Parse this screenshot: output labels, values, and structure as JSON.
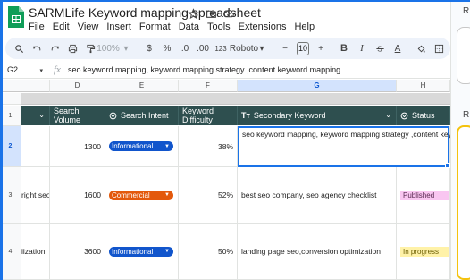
{
  "app": {
    "title": "SARMLife Keyword mapping spreadsheet",
    "menu": [
      "File",
      "Edit",
      "View",
      "Insert",
      "Format",
      "Data",
      "Tools",
      "Extensions",
      "Help"
    ]
  },
  "toolbar": {
    "zoom": "100%",
    "currency": "$",
    "percent": "%",
    "decrease_decimal": ".0",
    "increase_decimal": ".00",
    "number_format": "123",
    "font": "Roboto",
    "font_size": "10",
    "bold": "B",
    "italic": "I",
    "text_color": "A"
  },
  "formula_bar": {
    "cell_ref": "G2",
    "fx": "fx",
    "content": "seo keyword mapping, keyword mapping strategy ,content keyword mapping"
  },
  "columns": [
    "D",
    "E",
    "F",
    "G",
    "H"
  ],
  "rows": [
    "1",
    "2",
    "3",
    "4"
  ],
  "table": {
    "headers": {
      "search_volume": "Search Volume",
      "search_intent": "Search Intent",
      "keyword_difficulty": "Keyword Difficulty",
      "secondary_keyword": "Secondary Keyword",
      "status": "Status"
    },
    "rows": [
      {
        "partial": "",
        "volume": "1300",
        "intent": "Informational",
        "difficulty": "38%",
        "secondary": "seo keyword mapping, keyword mapping strategy ,content keyword mapping",
        "status": ""
      },
      {
        "partial": "right seo c",
        "volume": "1600",
        "intent": "Commercial",
        "difficulty": "52%",
        "secondary": "best seo company, seo agency checklist",
        "status": "Published"
      },
      {
        "partial": "iization",
        "volume": "3600",
        "intent": "Informational",
        "difficulty": "50%",
        "secondary": "landing page seo,conversion optimization",
        "status": "In progress"
      }
    ]
  },
  "side_panel": {
    "label_1": "R",
    "label_2": "R"
  },
  "colors": {
    "header_bg": "#2e4f4f",
    "informational": "#1155cc",
    "commercial": "#e3590c",
    "published": "#f9c6f1",
    "in_progress": "#fff2a8",
    "selection": "#1a73e8"
  }
}
